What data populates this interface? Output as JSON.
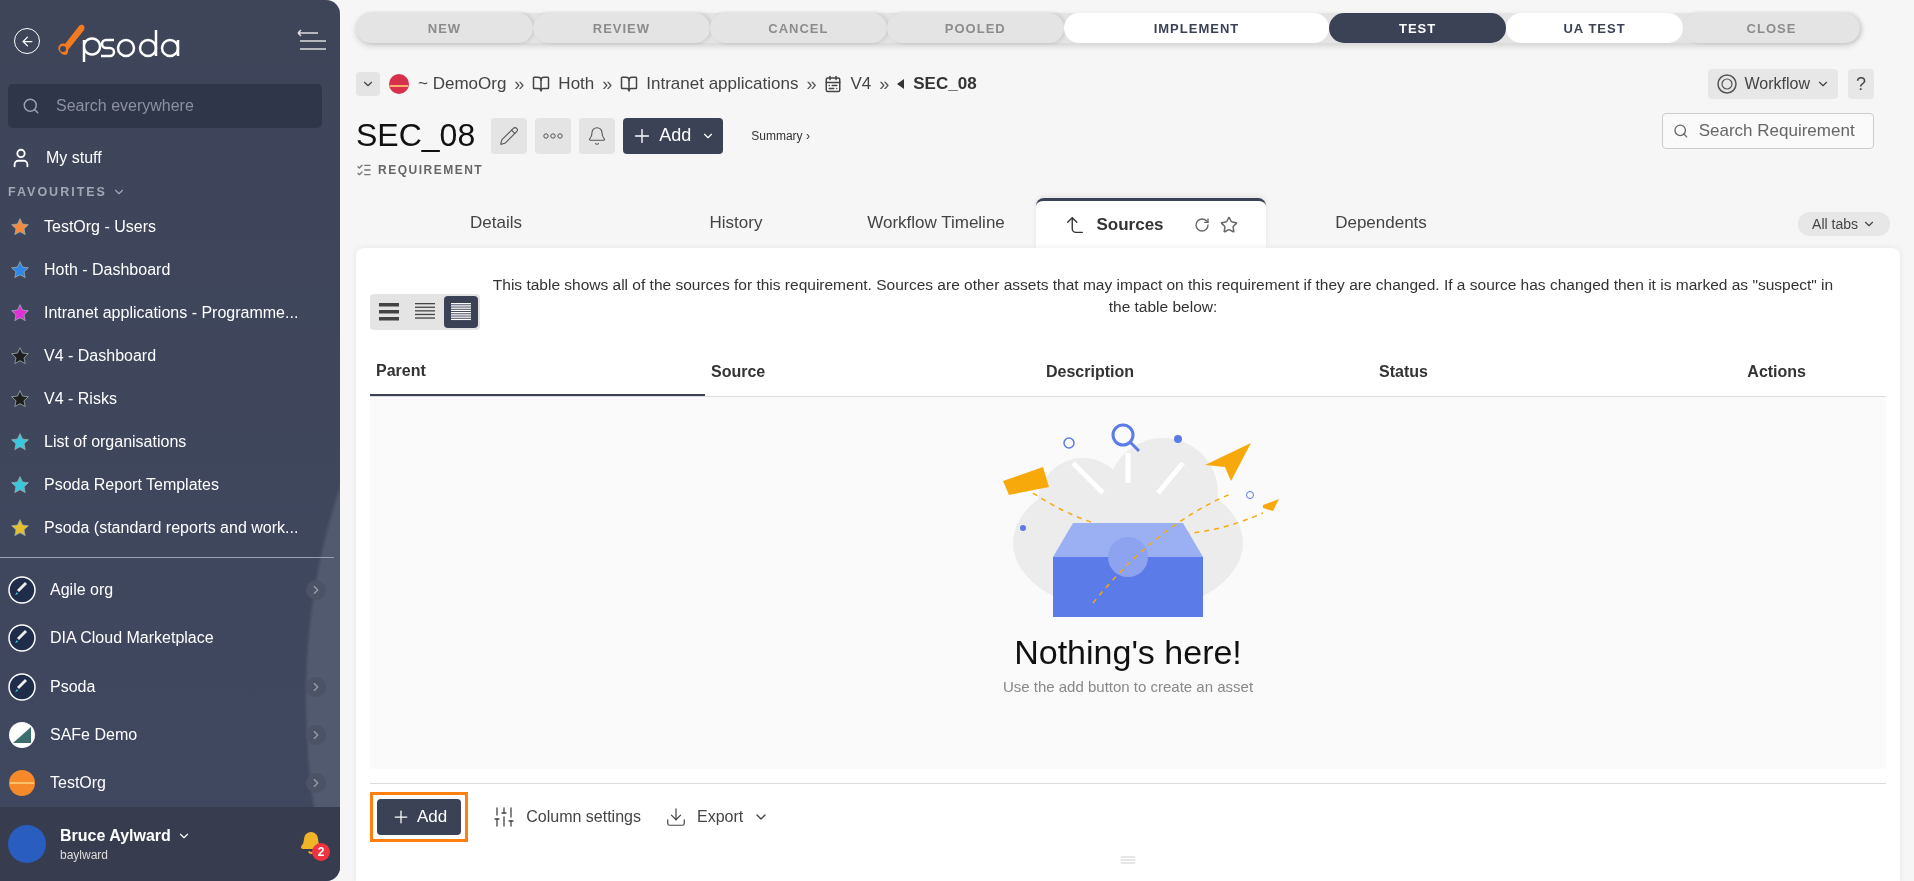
{
  "sidebar": {
    "search": {
      "placeholder": "Search everywhere"
    },
    "my_stuff": "My stuff",
    "favourites_heading": "FAVOURITES",
    "favourites": [
      {
        "label": "TestOrg - Users",
        "color": "#f58a3c"
      },
      {
        "label": "Hoth - Dashboard",
        "color": "#2f86e8"
      },
      {
        "label": "Intranet applications - Programme...",
        "color": "#e32fd8"
      },
      {
        "label": "V4 - Dashboard",
        "color": "#1e1e1e"
      },
      {
        "label": "V4 - Risks",
        "color": "#1e1e1e"
      },
      {
        "label": "List of organisations",
        "color": "#36c8dc"
      },
      {
        "label": "Psoda Report Templates",
        "color": "#36c8dc"
      },
      {
        "label": "Psoda (standard reports and work...",
        "color": "#e6c02a"
      }
    ],
    "organisations": [
      {
        "label": "Agile org",
        "kind": "rocket",
        "has_submenu": true
      },
      {
        "label": "DIA Cloud Marketplace",
        "kind": "rocket",
        "has_submenu": false
      },
      {
        "label": "Psoda",
        "kind": "rocket",
        "has_submenu": true
      },
      {
        "label": "SAFe Demo",
        "kind": "stripes",
        "has_submenu": true
      },
      {
        "label": "TestOrg",
        "kind": "sunset",
        "has_submenu": true
      }
    ],
    "user": {
      "name": "Bruce Aylward",
      "username": "baylward",
      "notifications": "2"
    }
  },
  "workflow_stages": [
    {
      "label": "NEW",
      "kind": "inactive",
      "selected": false
    },
    {
      "label": "REVIEW",
      "kind": "inactive",
      "selected": false
    },
    {
      "label": "CANCEL",
      "kind": "inactive",
      "selected": false
    },
    {
      "label": "POOLED",
      "kind": "inactive",
      "selected": false
    },
    {
      "label": "IMPLEMENT",
      "kind": "available",
      "selected": false
    },
    {
      "label": "TEST",
      "kind": "available",
      "selected": true
    },
    {
      "label": "UA TEST",
      "kind": "available",
      "selected": false
    },
    {
      "label": "CLOSE",
      "kind": "inactive",
      "selected": false
    }
  ],
  "breadcrumb": [
    {
      "label": "~ DemoOrg",
      "kind": "org",
      "separator": "»"
    },
    {
      "label": "Hoth",
      "kind": "book",
      "separator": "»"
    },
    {
      "label": "Intranet applications",
      "kind": "book",
      "separator": "»"
    },
    {
      "label": "V4",
      "kind": "board",
      "separator": "»"
    },
    {
      "label": "SEC_08",
      "kind": "current"
    }
  ],
  "header": {
    "title": "SEC_08",
    "add_button": "Add",
    "summary_link": "Summary ›",
    "type_label": "REQUIREMENT",
    "workflow_button": "Workflow",
    "help_button": "?",
    "search": {
      "placeholder": "Search Requirement"
    }
  },
  "tabs": [
    {
      "label": "Details",
      "selected": false
    },
    {
      "label": "History",
      "selected": false
    },
    {
      "label": "Workflow Timeline",
      "selected": false
    },
    {
      "label": "Sources",
      "selected": true
    },
    {
      "label": "Dependents",
      "selected": false
    }
  ],
  "all_tabs": "All tabs",
  "sources_panel": {
    "description": "This table shows all of the sources for this requirement. Sources are other assets that may impact on this requirement if they are changed. If a source has changed then it is marked as \"suspect\" in the table below:",
    "view_modes": [
      {
        "kind": "compact",
        "selected": false
      },
      {
        "kind": "normal",
        "selected": false
      },
      {
        "kind": "dense",
        "selected": true
      }
    ],
    "table": {
      "columns": [
        {
          "label": "Parent",
          "sorted": true
        },
        {
          "label": "Source",
          "sorted": false
        },
        {
          "label": "Description",
          "sorted": false
        },
        {
          "label": "Status",
          "sorted": false
        },
        {
          "label": "Actions",
          "sorted": false
        }
      ]
    },
    "empty_state": {
      "title": "Nothing's here!",
      "hint": "Use the add button to create an asset"
    },
    "toolbar": {
      "add": "Add",
      "add_highlighted": true,
      "column_settings": "Column settings",
      "export": "Export"
    }
  }
}
